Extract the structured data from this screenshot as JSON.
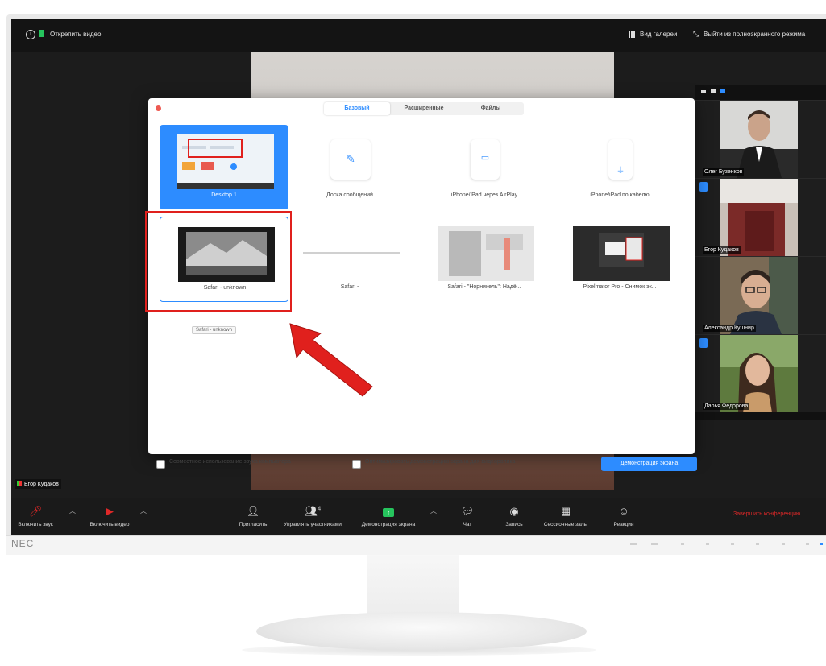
{
  "topbar": {
    "stop_video": "Открепить видео",
    "gallery_view": "Вид галереи",
    "exit_fullscreen": "Выйти из полноэкранного режима"
  },
  "dialog": {
    "tabs": [
      "Базовый",
      "Расширенные",
      "Файлы"
    ],
    "items": [
      {
        "label": "Desktop 1"
      },
      {
        "label": "Доска сообщений"
      },
      {
        "label": "iPhone/iPad через AirPlay"
      },
      {
        "label": "iPhone/iPad по кабелю"
      },
      {
        "label": "Safari - unknown"
      },
      {
        "label": "Safari -"
      },
      {
        "label": "Safari - \"Норникель\": Надё..."
      },
      {
        "label": "Pixelmator Pro - Снимок эк..."
      }
    ],
    "tooltip": "Safari - unknown",
    "share_sound": "Совместное использование звука компьютера",
    "optimize_video": "Оптимизировать демонстрацию экрана для видеоролика",
    "share_button": "Демонстрация экрана"
  },
  "participants": [
    {
      "name": "Олег Бузенков"
    },
    {
      "name": "Егор Кудаков"
    },
    {
      "name": "Александр Кушнир"
    },
    {
      "name": "Дарья Федорова"
    }
  ],
  "self_name": "Егор Кудаков",
  "toolbar": {
    "mute": "Включить звук",
    "video": "Включить видео",
    "invite": "Пригласить",
    "participants": "Управлять участниками",
    "participants_count": "4",
    "share": "Демонстрация экрана",
    "chat": "Чат",
    "record": "Запись",
    "breakout": "Сессионные залы",
    "reactions": "Реакции",
    "end": "Завершить конференцию"
  },
  "monitor": {
    "brand": "NEC"
  },
  "colors": {
    "accent": "#2d8cff",
    "danger": "#e0201d",
    "end": "#e02828"
  }
}
